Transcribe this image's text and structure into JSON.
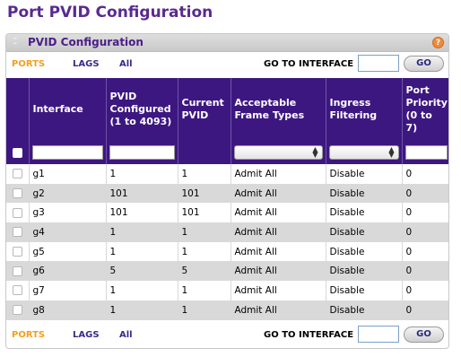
{
  "page_title": "Port PVID Configuration",
  "panel": {
    "title": "PVID Configuration",
    "help_icon": "?"
  },
  "filter_bar": {
    "ports": "PORTS",
    "lags": "LAGS",
    "all": "All",
    "goto_label": "GO TO INTERFACE",
    "goto_value": "",
    "go_label": "GO"
  },
  "table": {
    "headers": {
      "interface": "Interface",
      "pvid_configured": "PVID Configured (1 to 4093)",
      "current_pvid": "Current PVID",
      "acceptable_frame_types": "Acceptable Frame Types",
      "ingress_filtering": "Ingress Filtering",
      "port_priority": "Port Priority (0 to 7)"
    },
    "rows": [
      {
        "interface": "g1",
        "pvid_configured": "1",
        "current_pvid": "1",
        "frame_types": "Admit All",
        "ingress": "Disable",
        "priority": "0"
      },
      {
        "interface": "g2",
        "pvid_configured": "101",
        "current_pvid": "101",
        "frame_types": "Admit All",
        "ingress": "Disable",
        "priority": "0"
      },
      {
        "interface": "g3",
        "pvid_configured": "101",
        "current_pvid": "101",
        "frame_types": "Admit All",
        "ingress": "Disable",
        "priority": "0"
      },
      {
        "interface": "g4",
        "pvid_configured": "1",
        "current_pvid": "1",
        "frame_types": "Admit All",
        "ingress": "Disable",
        "priority": "0"
      },
      {
        "interface": "g5",
        "pvid_configured": "1",
        "current_pvid": "1",
        "frame_types": "Admit All",
        "ingress": "Disable",
        "priority": "0"
      },
      {
        "interface": "g6",
        "pvid_configured": "5",
        "current_pvid": "5",
        "frame_types": "Admit All",
        "ingress": "Disable",
        "priority": "0"
      },
      {
        "interface": "g7",
        "pvid_configured": "1",
        "current_pvid": "1",
        "frame_types": "Admit All",
        "ingress": "Disable",
        "priority": "0"
      },
      {
        "interface": "g8",
        "pvid_configured": "1",
        "current_pvid": "1",
        "frame_types": "Admit All",
        "ingress": "Disable",
        "priority": "0"
      }
    ]
  },
  "colors": {
    "title": "#5a2a8f",
    "header_bg": "#3d1780",
    "ports_link": "#f0a020",
    "link": "#3a2a8a",
    "row_alt": "#d9d9d9"
  }
}
